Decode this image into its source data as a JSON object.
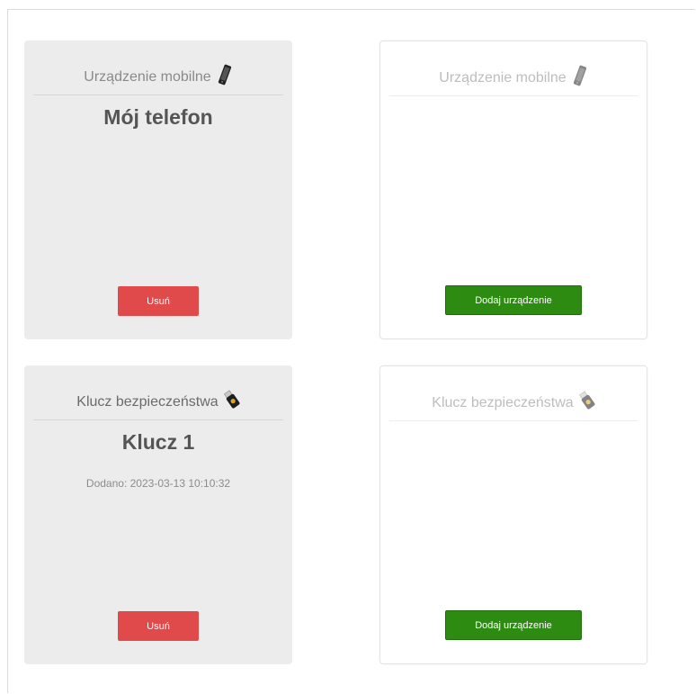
{
  "cards": [
    {
      "state": "active",
      "type_label": "Urządzenie mobilne",
      "icon": "mobile-phone-icon",
      "name": "Mój telefon",
      "meta": "",
      "button_label": "Usuń"
    },
    {
      "state": "empty",
      "type_label": "Urządzenie mobilne",
      "icon": "mobile-phone-icon",
      "name": "",
      "meta": "",
      "button_label": "Dodaj urządzenie"
    },
    {
      "state": "active",
      "type_label": "Klucz bezpieczeństwa",
      "icon": "security-key-icon",
      "name": "Klucz 1",
      "meta": "Dodano: 2023-03-13 10:10:32",
      "button_label": "Usuń"
    },
    {
      "state": "empty",
      "type_label": "Klucz bezpieczeństwa",
      "icon": "security-key-icon",
      "name": "",
      "meta": "",
      "button_label": "Dodaj urządzenie"
    }
  ],
  "colors": {
    "remove_button": "#e04a4a",
    "add_button": "#2e8b12",
    "active_card_bg": "#ececec",
    "empty_card_bg": "#ffffff"
  }
}
